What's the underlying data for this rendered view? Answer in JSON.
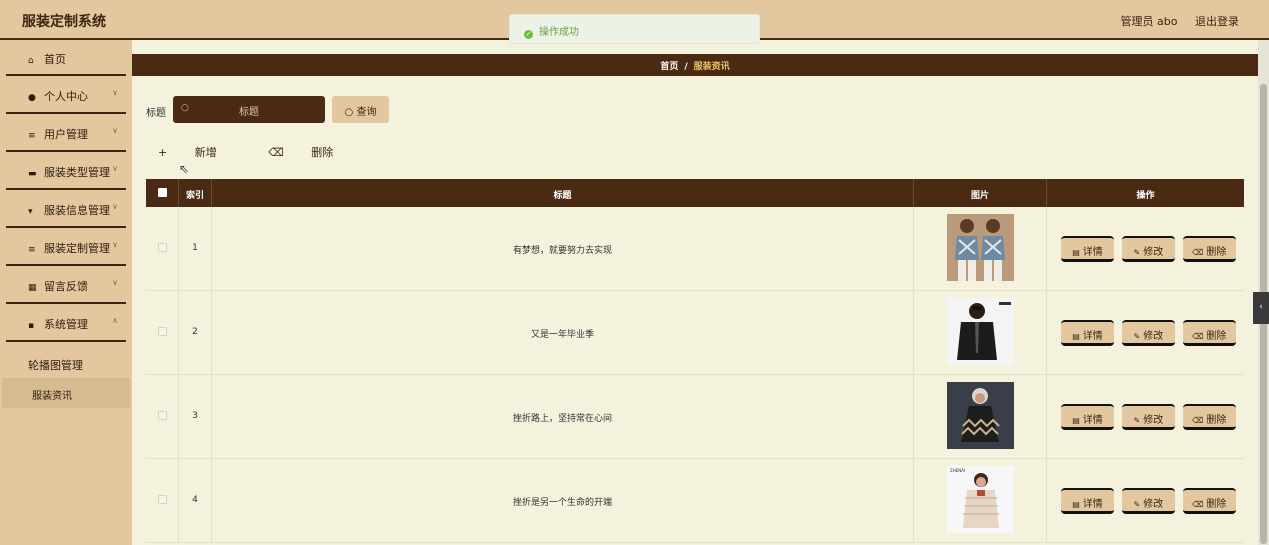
{
  "app": {
    "title": "服装定制系统"
  },
  "header": {
    "user_label": "管理员 abo",
    "logout_label": "退出登录"
  },
  "toast": {
    "message": "操作成功"
  },
  "sidebar": {
    "items": [
      {
        "label": "首页",
        "icon": "home-icon",
        "glyph": "⌂",
        "has_chevron": false
      },
      {
        "label": "个人中心",
        "icon": "user-icon",
        "glyph": "●",
        "has_chevron": true
      },
      {
        "label": "用户管理",
        "icon": "sliders-icon",
        "glyph": "≡",
        "has_chevron": true
      },
      {
        "label": "服装类型管理",
        "icon": "folder-icon",
        "glyph": "▬",
        "has_chevron": true
      },
      {
        "label": "服装信息管理",
        "icon": "shirt-icon",
        "glyph": "▾",
        "has_chevron": true
      },
      {
        "label": "服装定制管理",
        "icon": "list-icon",
        "glyph": "≡",
        "has_chevron": true
      },
      {
        "label": "留言反馈",
        "icon": "grid-icon",
        "glyph": "▦",
        "has_chevron": true
      },
      {
        "label": "系统管理",
        "icon": "apps-icon",
        "glyph": "▪",
        "has_chevron": true
      }
    ],
    "sub_items": [
      {
        "label": "轮播图管理",
        "active": false
      },
      {
        "label": "服装资讯",
        "active": true
      }
    ]
  },
  "breadcrumb": {
    "home": "首页",
    "separator": "/",
    "current": "服装资讯"
  },
  "search": {
    "label": "标题",
    "placeholder": "标题",
    "button_label": "查询"
  },
  "actions": {
    "add_label": "新增",
    "delete_label": "删除"
  },
  "table": {
    "columns": {
      "index": "索引",
      "title": "标题",
      "image": "图片",
      "ops": "操作"
    },
    "op_labels": {
      "detail": "详情",
      "edit": "修改",
      "delete": "删除"
    },
    "rows": [
      {
        "index": "1",
        "title": "有梦想，就要努力去实现",
        "image_desc": "two women in patterned tops"
      },
      {
        "index": "2",
        "title": "又是一年毕业季",
        "image_desc": "man in black jacket"
      },
      {
        "index": "3",
        "title": "挫折路上，坚持常在心间",
        "image_desc": "girl in zigzag dress"
      },
      {
        "index": "4",
        "title": "挫折是另一个生命的开端",
        "image_desc": "boy in padded coat",
        "brand_mark": "ZHENAI"
      }
    ]
  },
  "colors": {
    "accent_dark": "#4a2a12",
    "accent_light": "#e2c79f",
    "background": "#f4f1dd",
    "success": "#67c23a"
  }
}
